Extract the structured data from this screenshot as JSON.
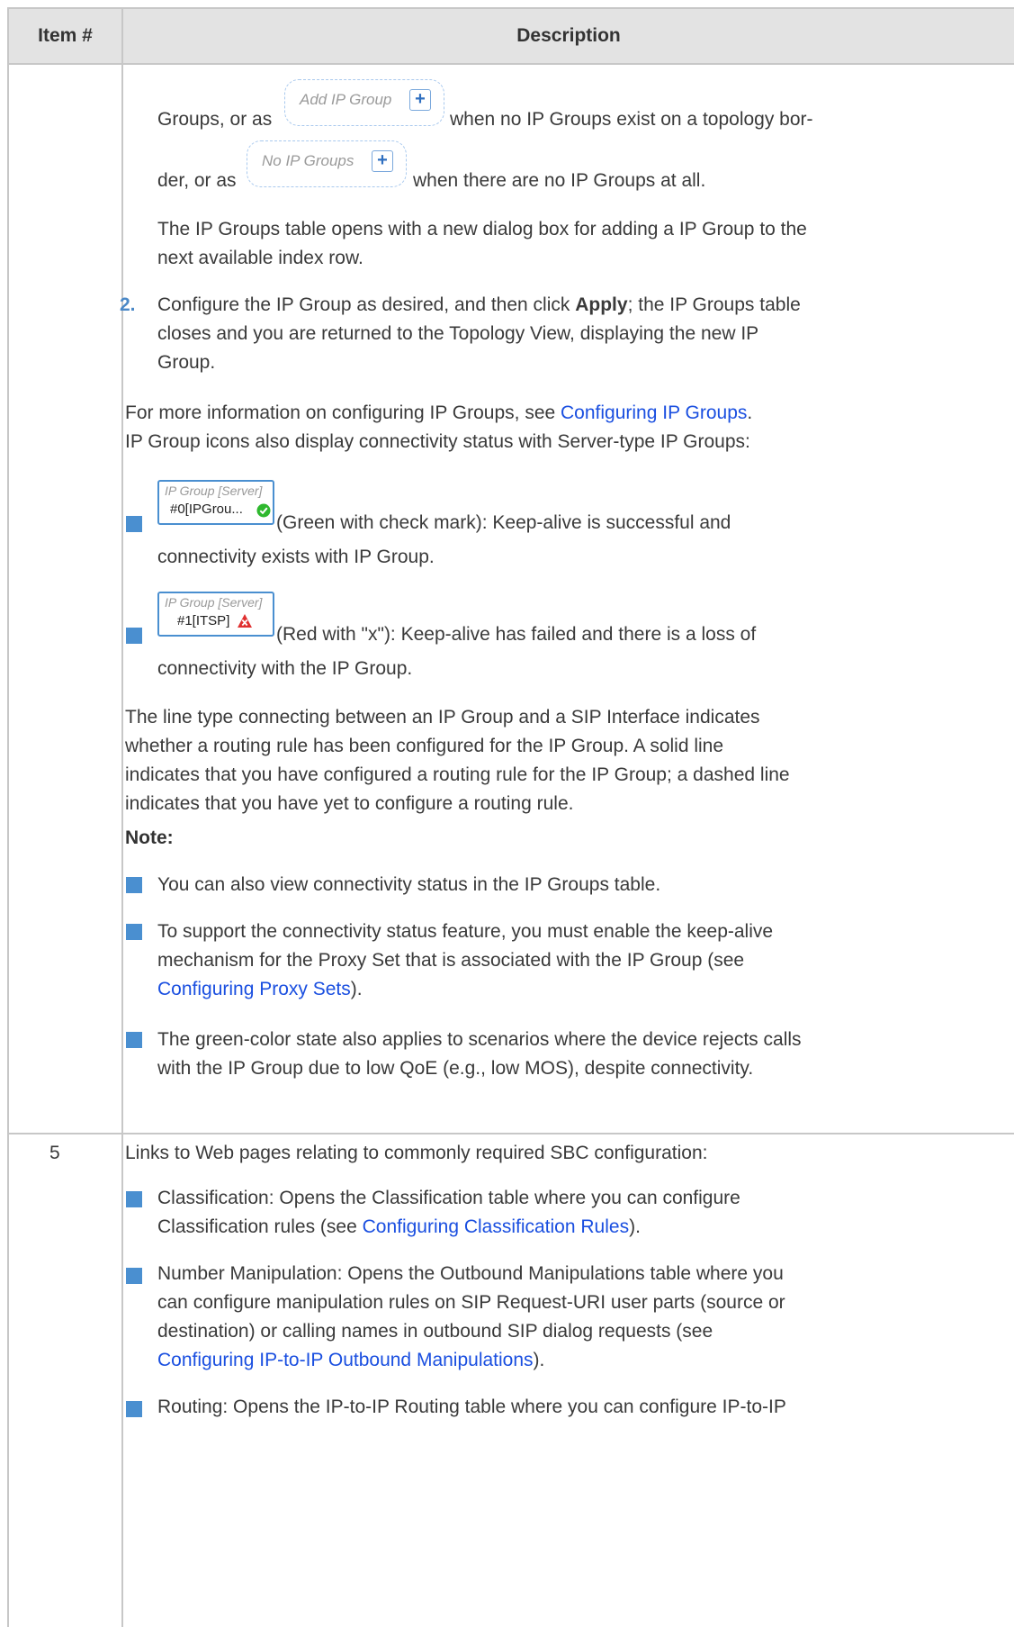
{
  "header": {
    "col_item": "Item #",
    "col_desc": "Description"
  },
  "row4": {
    "line1_a": "Groups, or as",
    "btn_add_label": "Add IP Group",
    "line1_b": "when no IP Groups exist on a topology bor-",
    "line2_a": "der, or as",
    "btn_none_label": "No IP Groups",
    "line2_b": "when there are no IP Groups at all.",
    "para1": [
      "The IP Groups table opens with a new dialog box for adding a IP Group to the",
      "next available index row."
    ],
    "step2_num": "2.",
    "step2_l1_a": "Configure the IP Group as desired, and then click ",
    "step2_l1_bold": "Apply",
    "step2_l1_b": "; the IP Groups table",
    "step2_l2": "closes and you are returned to the Topology View, displaying the new IP",
    "step2_l3": "Group.",
    "more_a": "For more information on configuring IP Groups, see ",
    "more_link": "Configuring IP Groups",
    "more_b": ".",
    "icons_intro": "IP Group icons also display connectivity status with Server-type IP Groups:",
    "green_cap": "IP Group [Server]",
    "green_name": "#0[IPGrou...",
    "green_l1": "(Green with check mark): Keep-alive is successful and",
    "green_l2": "connectivity exists with IP Group.",
    "red_cap": "IP Group [Server]",
    "red_name": "#1[ITSP]",
    "red_l1": "(Red with \"x\"): Keep-alive has failed and there is a loss of",
    "red_l2": "connectivity with the IP Group.",
    "line_para": [
      "The line type connecting between an IP Group and a SIP Interface indicates",
      "whether a routing rule has been configured for the IP Group. A solid line",
      "indicates that you have configured a routing rule for the IP Group; a dashed line",
      "indicates that you have yet to configure a routing rule."
    ],
    "note": "Note:",
    "note1": "You can also view connectivity status in the IP Groups table.",
    "note2_l1": "To support the connectivity status feature, you must enable the keep-alive",
    "note2_l2": "mechanism for the Proxy Set that is associated with the IP Group (see",
    "note2_link": "Configuring Proxy Sets",
    "note2_end": ").",
    "note3_l1": "The green-color state also applies to scenarios where the device rejects calls",
    "note3_l2": "with the IP Group due to low QoE (e.g., low MOS), despite connectivity."
  },
  "row5": {
    "item": "5",
    "intro": "Links to Web pages relating to commonly required SBC configuration:",
    "c_l1": "Classification: Opens the Classification table where you can configure",
    "c_l2_a": "Classification rules (see ",
    "c_link": "Configuring Classification Rules",
    "c_l2_b": ").",
    "n_l1": "Number Manipulation: Opens the Outbound Manipulations table where you",
    "n_l2": "can configure manipulation rules on SIP Request-URI user parts (source or",
    "n_l3": "destination) or calling names in outbound SIP dialog requests (see",
    "n_link": "Configuring IP-to-IP Outbound Manipulations",
    "n_end": ").",
    "r_l1": "Routing: Opens the IP-to-IP Routing table where you can configure IP-to-IP"
  },
  "colors": {
    "link": "#1a4fe0",
    "bullet": "#4a8fd0",
    "border": "#c7c7c7",
    "header_bg": "#e3e3e3",
    "ok": "#2eb82e",
    "fail": "#e03030"
  },
  "icons": [
    "plus-icon",
    "check-circle-icon",
    "warning-triangle-icon"
  ]
}
